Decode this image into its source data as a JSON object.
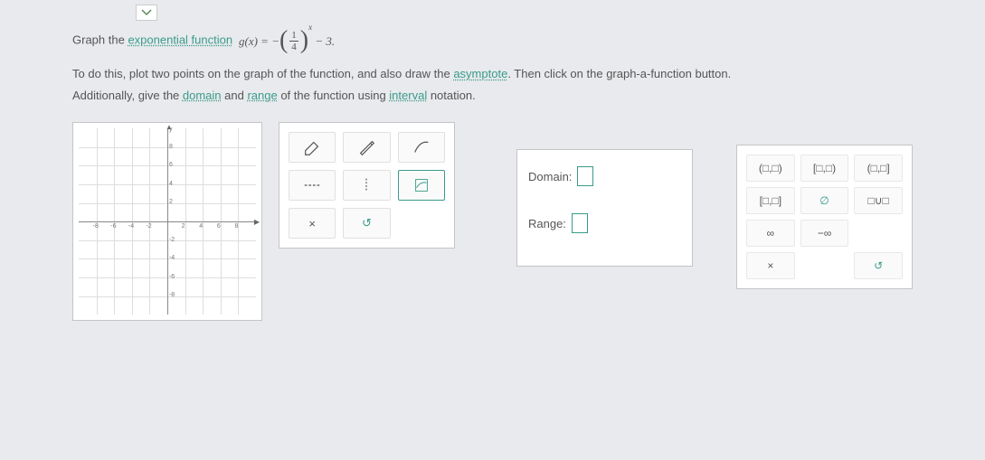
{
  "problem": {
    "text1_a": "Graph the ",
    "link1": "exponential function",
    "formula_left": " g(x) = −",
    "frac_num": "1",
    "frac_den": "4",
    "exp": "x",
    "formula_right": " − 3.",
    "text2_a": "To do this, plot two points on the graph of the function, and also draw the ",
    "link2": "asymptote",
    "text2_b": ". Then click on the graph-a-function button.",
    "text3_a": "Additionally, give the ",
    "link3a": "domain",
    "text3_b": " and ",
    "link3b": "range",
    "text3_c": " of the function using ",
    "link3c": "interval",
    "text3_d": " notation."
  },
  "graph": {
    "y_label": "y",
    "ticks_neg": [
      "-8",
      "-6",
      "-4",
      "-2"
    ],
    "ticks_pos": [
      "2",
      "4",
      "6",
      "8"
    ]
  },
  "tools": {
    "clear": "×",
    "reset": "↺"
  },
  "dr": {
    "domain_label": "Domain:",
    "range_label": "Range:"
  },
  "symbols": {
    "open_open": "(□,□)",
    "closed_open": "[□,□)",
    "open_closed": "(□,□]",
    "closed_closed": "[□,□]",
    "empty": "∅",
    "union": "□∪□",
    "inf": "∞",
    "ninf": "−∞",
    "clear": "×",
    "reset": "↺"
  }
}
